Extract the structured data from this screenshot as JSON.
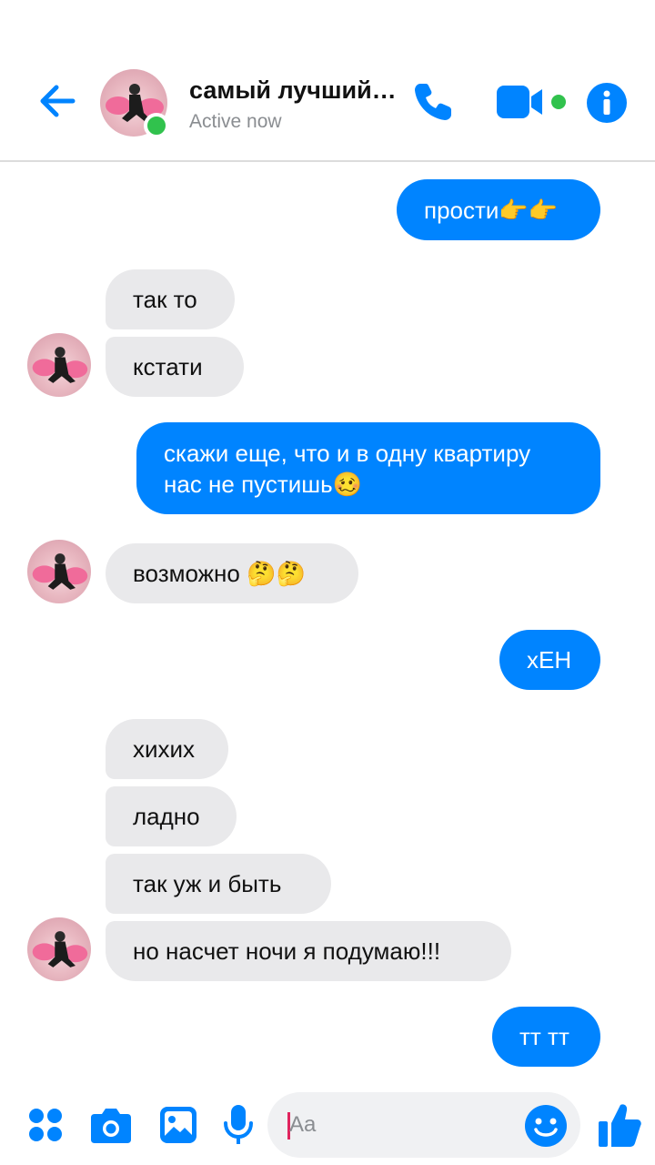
{
  "header": {
    "title": "самый лучший…",
    "status": "Active now"
  },
  "messages": [
    {
      "side": "out",
      "text": "прости👉👉"
    },
    {
      "side": "in",
      "text": "так то"
    },
    {
      "side": "in",
      "text": "кстати"
    },
    {
      "side": "out",
      "text": "скажи еще, что и в одну квартиру нас не пустишь🥴"
    },
    {
      "side": "in",
      "text": "возможно 🤔🤔"
    },
    {
      "side": "out",
      "text": "хЕН"
    },
    {
      "side": "in",
      "text": "хихих"
    },
    {
      "side": "in",
      "text": "ладно"
    },
    {
      "side": "in",
      "text": "так уж и быть"
    },
    {
      "side": "in",
      "text": "но насчет ночи я подумаю!!!"
    },
    {
      "side": "out",
      "text": "тт тт"
    }
  ],
  "composer": {
    "placeholder": "Aa"
  },
  "colors": {
    "accent": "#0084ff",
    "incoming_bubble": "#e9e9eb",
    "online": "#31c24d"
  },
  "icons": [
    "back-arrow-icon",
    "phone-icon",
    "video-camera-icon",
    "info-icon",
    "menu-dots-icon",
    "camera-icon",
    "image-icon",
    "microphone-icon",
    "smiley-icon",
    "thumbs-up-icon"
  ]
}
